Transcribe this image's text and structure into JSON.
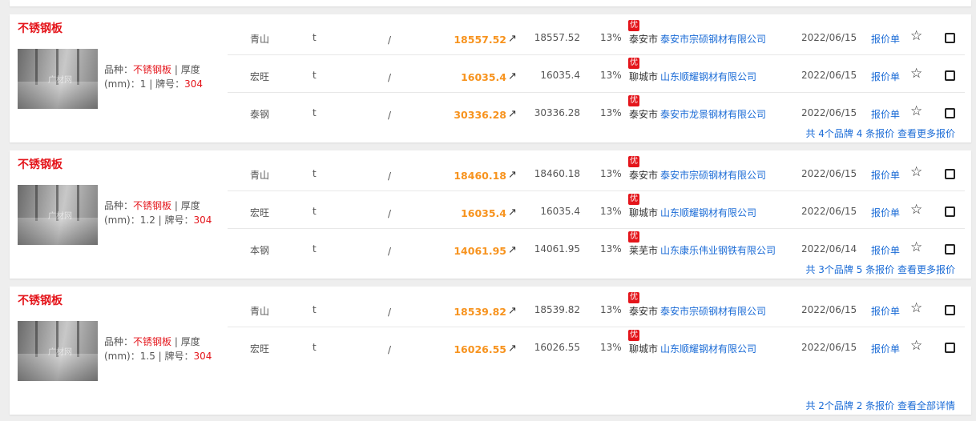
{
  "groups": [
    {
      "title": "不锈钢板",
      "spec": {
        "k1": "品种：",
        "v1": "不锈钢板",
        "sep1": " | ",
        "k2": "厚度(mm)：",
        "v2": "1",
        "sep2": " | ",
        "k3": "牌号：",
        "v3": "304"
      },
      "rows": [
        {
          "brand": "青山",
          "unit": "t",
          "slash": "/",
          "price": "18557.52",
          "ref": "18557.52",
          "pct": "13%",
          "badge": "优",
          "city": "泰安市",
          "company": "泰安市宗硕钢材有限公司",
          "date": "2022/06/15",
          "quote": "报价单"
        },
        {
          "brand": "宏旺",
          "unit": "t",
          "slash": "/",
          "price": "16035.4",
          "ref": "16035.4",
          "pct": "13%",
          "badge": "优",
          "city": "聊城市",
          "company": "山东顺耀钢材有限公司",
          "date": "2022/06/15",
          "quote": "报价单"
        },
        {
          "brand": "泰钢",
          "unit": "t",
          "slash": "/",
          "price": "30336.28",
          "ref": "30336.28",
          "pct": "13%",
          "badge": "优",
          "city": "泰安市",
          "company": "泰安市龙景钢材有限公司",
          "date": "2022/06/15",
          "quote": "报价单"
        }
      ],
      "summary": "共 4个品牌 4 条报价  查看更多报价"
    },
    {
      "title": "不锈钢板",
      "spec": {
        "k1": "品种：",
        "v1": "不锈钢板",
        "sep1": " | ",
        "k2": "厚度(mm)：",
        "v2": "1.2",
        "sep2": " | ",
        "k3": "牌号：",
        "v3": "304"
      },
      "rows": [
        {
          "brand": "青山",
          "unit": "t",
          "slash": "/",
          "price": "18460.18",
          "ref": "18460.18",
          "pct": "13%",
          "badge": "优",
          "city": "泰安市",
          "company": "泰安市宗硕钢材有限公司",
          "date": "2022/06/15",
          "quote": "报价单"
        },
        {
          "brand": "宏旺",
          "unit": "t",
          "slash": "/",
          "price": "16035.4",
          "ref": "16035.4",
          "pct": "13%",
          "badge": "优",
          "city": "聊城市",
          "company": "山东顺耀钢材有限公司",
          "date": "2022/06/15",
          "quote": "报价单"
        },
        {
          "brand": "本钢",
          "unit": "t",
          "slash": "/",
          "price": "14061.95",
          "ref": "14061.95",
          "pct": "13%",
          "badge": "优",
          "city": "莱芜市",
          "company": "山东康乐伟业钢铁有限公司",
          "date": "2022/06/14",
          "quote": "报价单"
        }
      ],
      "summary": "共 3个品牌 5 条报价  查看更多报价"
    },
    {
      "title": "不锈钢板",
      "spec": {
        "k1": "品种：",
        "v1": "不锈钢板",
        "sep1": " | ",
        "k2": "厚度(mm)：",
        "v2": "1.5",
        "sep2": " | ",
        "k3": "牌号：",
        "v3": "304"
      },
      "rows": [
        {
          "brand": "青山",
          "unit": "t",
          "slash": "/",
          "price": "18539.82",
          "ref": "18539.82",
          "pct": "13%",
          "badge": "优",
          "city": "泰安市",
          "company": "泰安市宗硕钢材有限公司",
          "date": "2022/06/15",
          "quote": "报价单"
        },
        {
          "brand": "宏旺",
          "unit": "t",
          "slash": "/",
          "price": "16026.55",
          "ref": "16026.55",
          "pct": "13%",
          "badge": "优",
          "city": "聊城市",
          "company": "山东顺耀钢材有限公司",
          "date": "2022/06/15",
          "quote": "报价单"
        }
      ],
      "summary": "共 2个品牌 2 条报价  查看全部详情"
    }
  ]
}
